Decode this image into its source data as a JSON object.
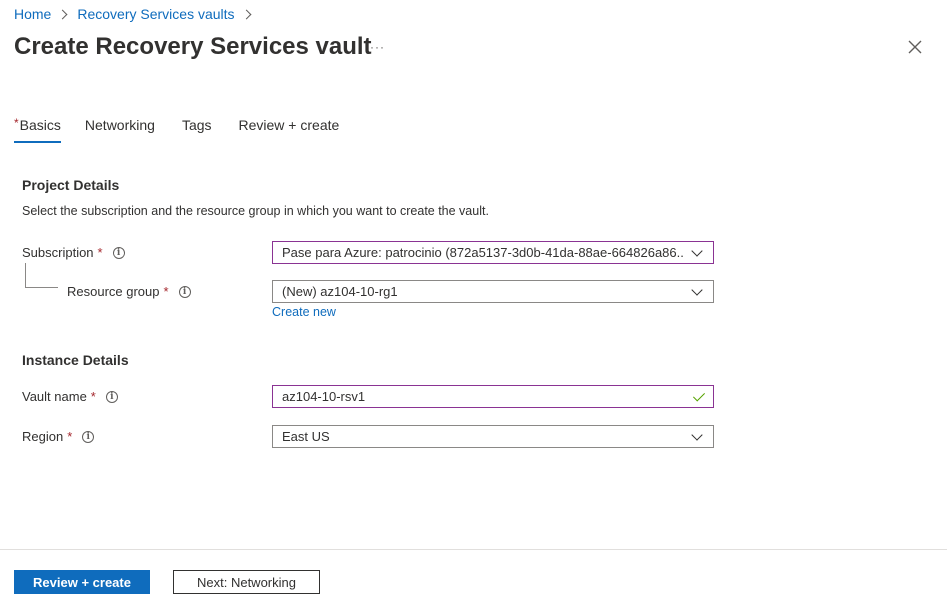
{
  "breadcrumb": {
    "items": [
      "Home",
      "Recovery Services vaults"
    ]
  },
  "header": {
    "title": "Create Recovery Services vault",
    "more_label": "···"
  },
  "tabs": [
    {
      "label": "Basics",
      "required_marker": "*",
      "active": true
    },
    {
      "label": "Networking"
    },
    {
      "label": "Tags"
    },
    {
      "label": "Review + create"
    }
  ],
  "project": {
    "title": "Project Details",
    "description": "Select the subscription and the resource group in which you want to create the vault.",
    "subscription": {
      "label": "Subscription",
      "required": "*",
      "value": "Pase para Azure: patrocinio (872a5137-3d0b-41da-88ae-664826a86..."
    },
    "resource_group": {
      "label": "Resource group",
      "required": "*",
      "value": "(New) az104-10-rg1",
      "create_new": "Create new"
    }
  },
  "instance": {
    "title": "Instance Details",
    "vault_name": {
      "label": "Vault name",
      "required": "*",
      "value": "az104-10-rsv1"
    },
    "region": {
      "label": "Region",
      "required": "*",
      "value": "East US"
    }
  },
  "footer": {
    "primary_label": "Review + create",
    "secondary_label": "Next: Networking"
  },
  "colors": {
    "accent": "#0f6cbd",
    "required": "#a4262c",
    "focus": "#8a3393",
    "valid": "#57a300"
  },
  "icons": [
    "chevron-right-icon",
    "more-icon",
    "close-icon",
    "info-icon",
    "chevron-down-icon",
    "checkmark-icon"
  ]
}
